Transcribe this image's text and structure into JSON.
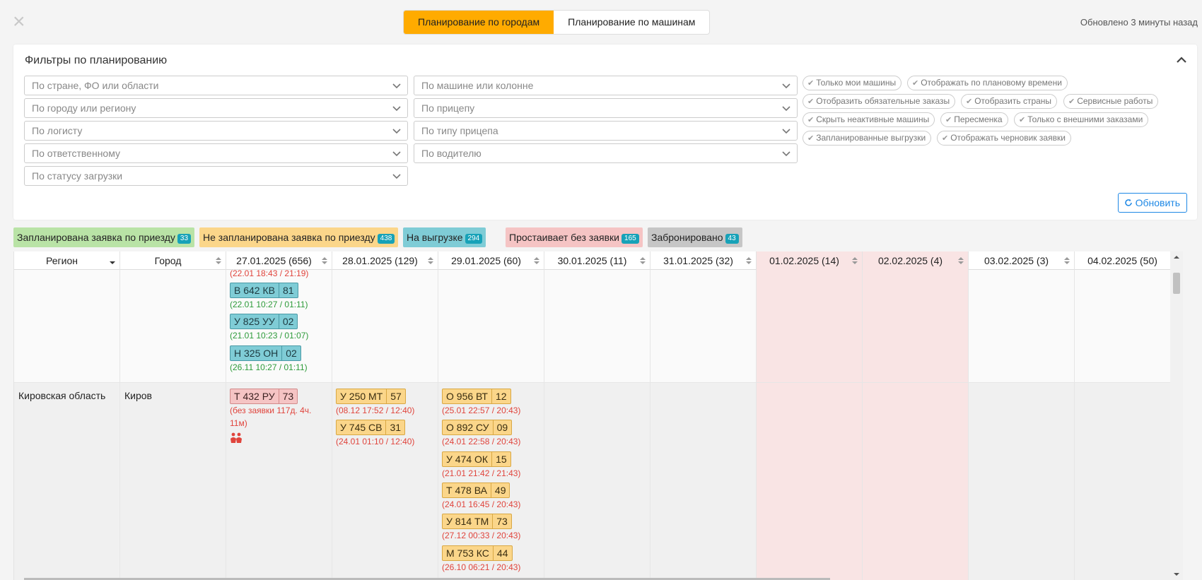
{
  "top": {
    "modes": [
      "Планирование по городам",
      "Планирование по машинам"
    ],
    "updated": "Обновлено 3 минуты назад"
  },
  "filters": {
    "title": "Фильтры по планированию",
    "left_selects": [
      "По стране, ФО или области",
      "По городу или региону",
      "По логисту",
      "По ответственному",
      "По статусу загрузки"
    ],
    "mid_selects": [
      "По машине или колонне",
      "По прицепу",
      "По типу прицепа",
      "По водителю"
    ],
    "chips": [
      "Только мои машины",
      "Отображать по плановому времени",
      "Отобразить обязательные заказы",
      "Отобразить страны",
      "Сервисные работы",
      "Скрыть неактивные машины",
      "Пересменка",
      "Только с внешними заказами",
      "Запланированные выгрузки",
      "Отображать черновик заявки"
    ],
    "refresh": "Обновить"
  },
  "legend": [
    {
      "label": "Запланирована заявка по приезду",
      "count": "33",
      "color": "#b9e3a6"
    },
    {
      "label": "Не запланирована заявка по приезду",
      "count": "438",
      "color": "#fbd68a"
    },
    {
      "label": "На выгрузке",
      "count": "294",
      "color": "#7fccd6"
    },
    {
      "label": "Простаивает без заявки",
      "count": "165",
      "color": "#f5c4c4"
    },
    {
      "label": "Забронировано",
      "count": "43",
      "color": "#c6c6c6"
    }
  ],
  "table": {
    "headers": [
      "Регион",
      "Город",
      "27.01.2025 (656)",
      "28.01.2025 (129)",
      "29.01.2025 (60)",
      "30.01.2025 (11)",
      "31.01.2025 (32)",
      "01.02.2025 (14)",
      "02.02.2025 (4)",
      "03.02.2025 (3)",
      "04.02.2025 (50)"
    ],
    "row_top": {
      "partial_info": "(22.01 18:43 / 21:19)",
      "trucks": [
        {
          "num": "В 642 КВ",
          "reg": "81",
          "info": "(22.01 10:27 / 01:11)"
        },
        {
          "num": "У 825 УУ",
          "reg": "02",
          "info": "(21.01 10:23 / 01:07)"
        },
        {
          "num": "Н 325 ОН",
          "reg": "02",
          "info": "(26.11 10:27 / 01:11)"
        }
      ]
    },
    "row_kirov": {
      "region": "Кировская область",
      "city": "Киров",
      "c27": [
        {
          "num": "Т 432 РУ",
          "reg": "73",
          "info1": "(без заявки 117д. 4ч.",
          "info2": "11м)"
        }
      ],
      "c28": [
        {
          "num": "У 250 МТ",
          "reg": "57",
          "info": "(08.12 17:52 / 12:40)"
        },
        {
          "num": "У 745 СВ",
          "reg": "31",
          "info": "(24.01 01:10 / 12:40)"
        }
      ],
      "c29": [
        {
          "num": "О 956 ВТ",
          "reg": "12",
          "info": "(25.01 22:57 / 20:43)"
        },
        {
          "num": "О 892 СУ",
          "reg": "09",
          "info": "(24.01 22:58 / 20:43)"
        },
        {
          "num": "У 474 ОК",
          "reg": "15",
          "info": "(21.01 21:42 / 21:43)"
        },
        {
          "num": "Т 478 ВА",
          "reg": "49",
          "info": "(24.01 16:45 / 20:43)"
        },
        {
          "num": "У 814 ТМ",
          "reg": "73",
          "info": "(27.12 00:33 / 20:43)"
        },
        {
          "num": "М 753 КС",
          "reg": "44",
          "info": "(26.10 06:21 / 20:43)"
        }
      ]
    }
  }
}
